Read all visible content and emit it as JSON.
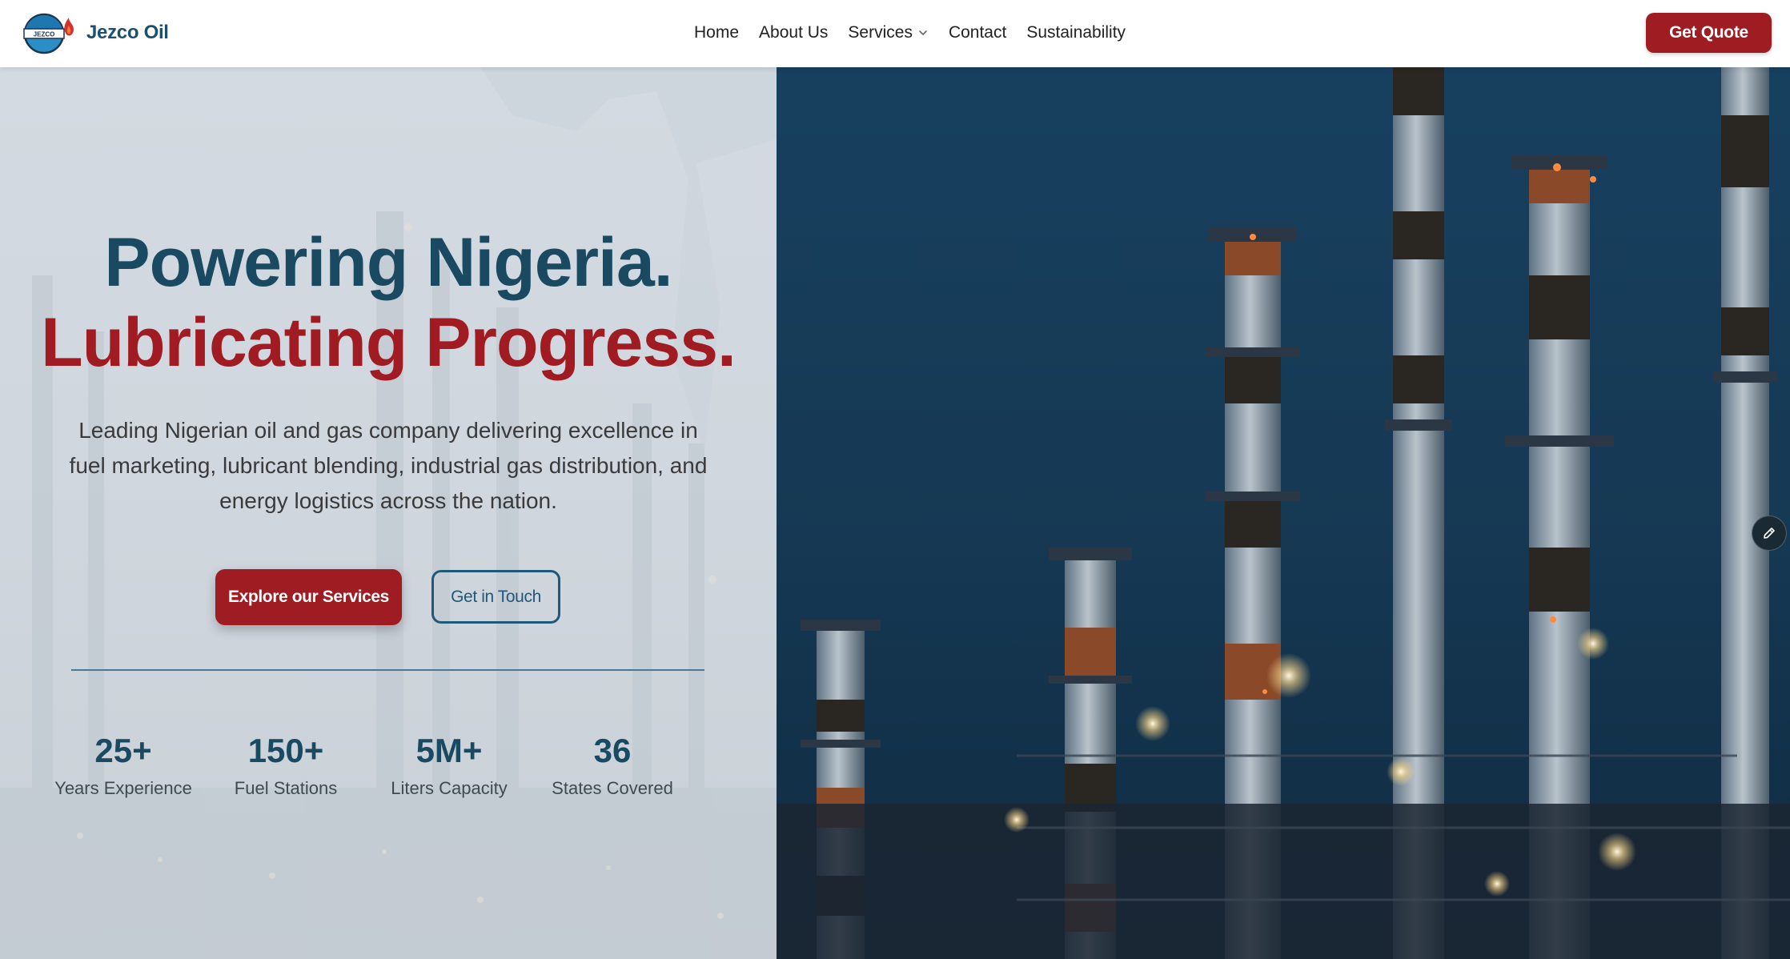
{
  "brand": {
    "name": "Jezco Oil",
    "logo_text": "JEZCO"
  },
  "nav": {
    "links": [
      {
        "label": "Home"
      },
      {
        "label": "About Us"
      },
      {
        "label": "Services",
        "has_dropdown": true
      },
      {
        "label": "Contact"
      },
      {
        "label": "Sustainability"
      }
    ],
    "cta_label": "Get Quote"
  },
  "hero": {
    "headline_line1": "Powering Nigeria.",
    "headline_line2": "Lubricating Progress.",
    "description": "Leading Nigerian oil and gas company delivering excellence in fuel marketing, lubricant blending, industrial gas distribution, and energy logistics across the nation.",
    "primary_button": "Explore our Services",
    "secondary_button": "Get in Touch"
  },
  "stats": [
    {
      "value": "25+",
      "label": "Years Experience"
    },
    {
      "value": "150+",
      "label": "Fuel Stations"
    },
    {
      "value": "5M+",
      "label": "Liters Capacity"
    },
    {
      "value": "36",
      "label": "States Covered"
    }
  ],
  "icons": {
    "logo": "jezco-logo-icon",
    "dropdown": "chevron-down-icon",
    "edit": "pencil-icon"
  },
  "colors": {
    "brand_blue": "#1a4a62",
    "brand_red": "#9e1c22",
    "hero_left_bg": "#d1d8df",
    "hero_right_bg": "#173a55"
  }
}
